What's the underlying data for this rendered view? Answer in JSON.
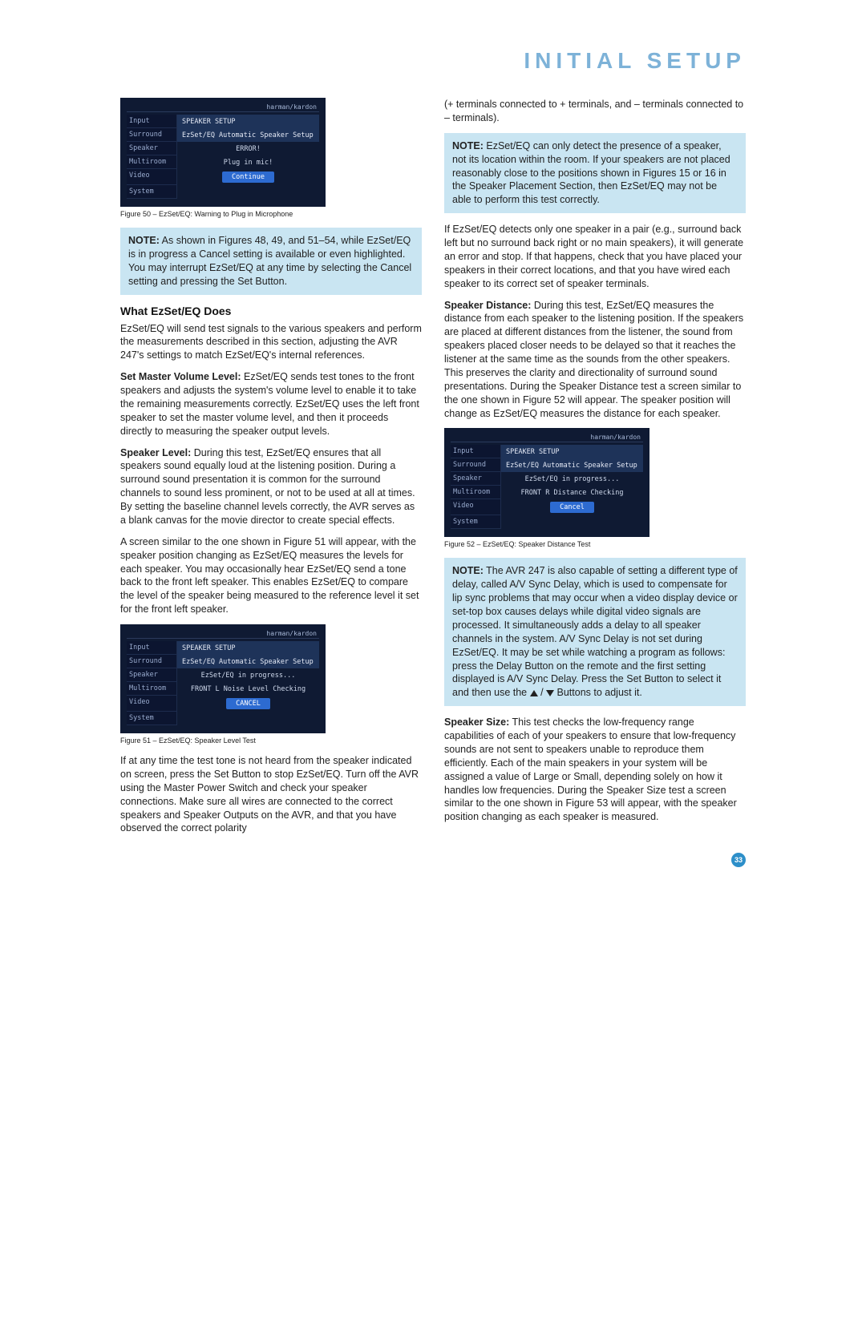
{
  "page": {
    "title": "INITIAL SETUP",
    "number": "33"
  },
  "osd_brand": "harman/kardon",
  "osd_sidebar": [
    "Input",
    "Surround",
    "Speaker",
    "Multiroom",
    "Video",
    "System"
  ],
  "fig50": {
    "title": "SPEAKER SETUP",
    "sub": "EzSet/EQ Automatic Speaker Setup",
    "line1": "ERROR!",
    "line2": "Plug in mic!",
    "button": "Continue",
    "caption": "Figure 50 – EzSet/EQ: Warning to Plug in Microphone"
  },
  "fig51": {
    "title": "SPEAKER SETUP",
    "sub": "EzSet/EQ Automatic Speaker Setup",
    "line1": "EzSet/EQ in progress...",
    "line2": "FRONT L  Noise Level Checking",
    "button": "CANCEL",
    "caption": "Figure 51 – EzSet/EQ: Speaker Level Test"
  },
  "fig52": {
    "title": "SPEAKER SETUP",
    "sub": "EzSet/EQ Automatic Speaker Setup",
    "line1": "EzSet/EQ in progress...",
    "line2": "FRONT R  Distance Checking",
    "button": "Cancel",
    "caption": "Figure 52 – EzSet/EQ: Speaker Distance Test"
  },
  "note1": {
    "label": "NOTE:",
    "text": " As shown in Figures 48, 49, and 51–54, while EzSet/EQ is in progress a Cancel setting is available or even highlighted. You may interrupt EzSet/EQ at any time by selecting the Cancel setting and pressing the Set Button."
  },
  "heading1": "What EzSet/EQ Does",
  "p1": "EzSet/EQ will send test signals to the various speakers and perform the measurements described in this section, adjusting the AVR 247's settings to match EzSet/EQ's internal references.",
  "p2_label": "Set Master Volume Level:",
  "p2": " EzSet/EQ sends test tones to the front speakers and adjusts the system's volume level to enable it to take the remaining measurements correctly. EzSet/EQ uses the left front speaker to set the master volume level, and then it proceeds directly to measuring the speaker output levels.",
  "p3_label": "Speaker Level:",
  "p3": " During this test, EzSet/EQ ensures that all speakers sound equally loud at the listening position. During a surround sound presentation it is common for the surround channels to sound less prominent, or not to be used at all at times. By setting the baseline channel levels correctly, the AVR serves as a blank canvas for the movie director to create special effects.",
  "p4": "A screen similar to the one shown in Figure 51 will appear, with the speaker position changing as EzSet/EQ measures the levels for each speaker. You may occasionally hear EzSet/EQ send a tone back to the front left speaker. This enables EzSet/EQ to compare the level of the speaker being measured to the reference level it set for the front left speaker.",
  "p5": "If at any time the test tone is not heard from the speaker indicated on screen, press the Set Button to stop EzSet/EQ. Turn off the AVR using the Master Power Switch and check your speaker connections. Make sure all wires are connected to the correct speakers and Speaker Outputs on the AVR, and that you have observed the correct polarity",
  "p6": "(+ terminals connected to + terminals, and – terminals connected to – terminals).",
  "note2": {
    "label": "NOTE:",
    "text": " EzSet/EQ can only detect the presence of a speaker, not its location within the room. If your speakers are not placed reasonably close to the positions shown in Figures 15 or 16 in the Speaker Placement Section, then EzSet/EQ may not be able to perform this test correctly."
  },
  "p7": "If EzSet/EQ detects only one speaker in a pair (e.g., surround back left but no surround back right or no main speakers), it will generate an error and stop. If that happens, check that you have placed your speakers in their correct locations, and that you have wired each speaker to its correct set of speaker terminals.",
  "p8_label": "Speaker Distance:",
  "p8": " During this test, EzSet/EQ measures the distance from each speaker to the listening position. If the speakers are placed at different distances from the listener, the sound from speakers placed closer needs to be delayed so that it reaches the listener at the same time as the sounds from the other speakers. This preserves the clarity and directionality of surround sound presentations. During the Speaker Distance test a screen similar to the one shown in Figure 52 will appear. The speaker position will change as EzSet/EQ measures the distance for each speaker.",
  "note3": {
    "label": "NOTE:",
    "text_a": " The AVR 247 is also capable of setting a different type of delay, called A/V Sync Delay, which is used to compensate for lip sync problems that may occur when a video display device or set-top box causes delays while digital video signals are processed. It simultaneously adds a delay to all speaker channels in the system. A/V Sync Delay is not set during EzSet/EQ. It may be set while watching a program as follows: press the Delay Button on the remote and the first setting displayed is A/V Sync Delay. Press the Set Button to select it and then use the ",
    "text_b": " Buttons to adjust it."
  },
  "p9_label": "Speaker Size:",
  "p9": " This test checks the low-frequency range capabilities of each of your speakers to ensure that low-frequency sounds are not sent to speakers unable to reproduce them efficiently. Each of the main speakers in your system will be assigned a value of Large or Small, depending solely on how it handles low frequencies. During the Speaker Size test a screen similar to the one shown in Figure 53 will appear, with the speaker position changing as each speaker is measured."
}
